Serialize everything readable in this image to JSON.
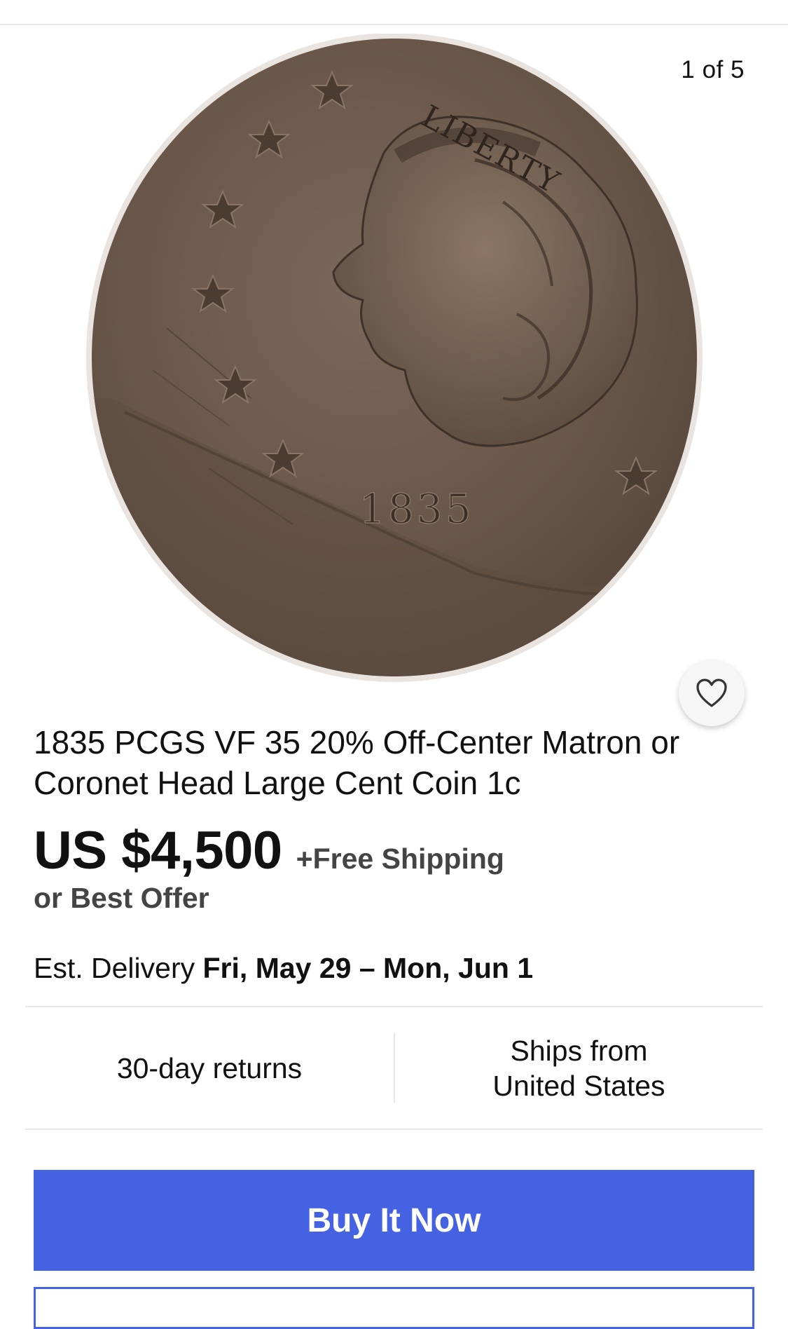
{
  "gallery": {
    "counter": "1 of 5",
    "image_alt": "1835 large cent coin obverse",
    "coin_inscription": "LIBERTY",
    "coin_date": "1835"
  },
  "watch_button": {
    "icon": "heart-icon"
  },
  "listing": {
    "title": "1835 PCGS VF 35 20% Off-Center Matron or Coronet Head Large Cent Coin 1c",
    "price": "US $4,500",
    "shipping": "+Free Shipping",
    "best_offer": "or Best Offer",
    "delivery_prefix": "Est. Delivery",
    "delivery_dates": "Fri, May 29 – Mon, Jun 1"
  },
  "info": {
    "returns": "30-day returns",
    "ships_line1": "Ships from",
    "ships_line2": "United States"
  },
  "actions": {
    "buy_now": "Buy It Now"
  },
  "colors": {
    "accent": "#4562e3",
    "coin_base": "#6e5a4c",
    "divider": "#e8e8e8"
  }
}
